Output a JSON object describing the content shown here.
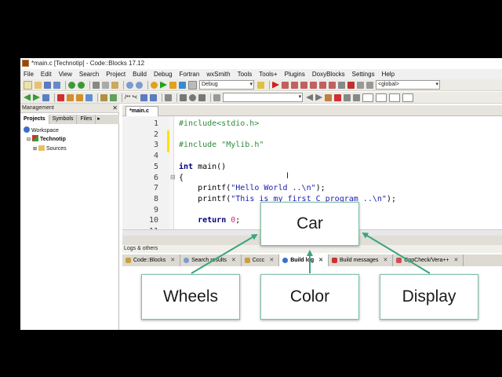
{
  "window": {
    "title": "*main.c [Technotip] - Code::Blocks 17.12"
  },
  "menu": [
    "File",
    "Edit",
    "View",
    "Search",
    "Project",
    "Build",
    "Debug",
    "Fortran",
    "wxSmith",
    "Tools",
    "Tools+",
    "Plugins",
    "DoxyBlocks",
    "Settings",
    "Help"
  ],
  "toolbar": {
    "build_target": "Debug",
    "scope": "<global>",
    "comment_label": "/** *<"
  },
  "management": {
    "title": "Management",
    "tabs": [
      "Projects",
      "Symbols",
      "Files"
    ],
    "active_tab": "Projects",
    "tree": {
      "workspace": "Workspace",
      "project": "Technotip",
      "folder": "Sources"
    }
  },
  "editor": {
    "tab": "*main.c",
    "lines": [
      {
        "n": "1",
        "text": "#include<stdio.h>"
      },
      {
        "n": "2",
        "text": ""
      },
      {
        "n": "3",
        "text": "#include \"Mylib.h\""
      },
      {
        "n": "4",
        "text": ""
      },
      {
        "n": "5",
        "text": "int main()"
      },
      {
        "n": "6",
        "text": "{"
      },
      {
        "n": "7",
        "text": "    printf(\"Hello World ..\\n\");"
      },
      {
        "n": "8",
        "text": "    printf(\"This is my first C program ..\\n\");"
      },
      {
        "n": "9",
        "text": ""
      },
      {
        "n": "10",
        "text": "    return 0;"
      },
      {
        "n": "11",
        "text": ""
      }
    ]
  },
  "logs": {
    "title": "Logs & others",
    "tabs": [
      "Code::Blocks",
      "Search results",
      "Cccc",
      "Build log",
      "Build messages",
      "CppCheck/Vera++"
    ],
    "active_tab": "Build log"
  },
  "diagram": {
    "parent": "Car",
    "children": [
      "Wheels",
      "Color",
      "Display"
    ],
    "accent": "#3aa57e"
  }
}
